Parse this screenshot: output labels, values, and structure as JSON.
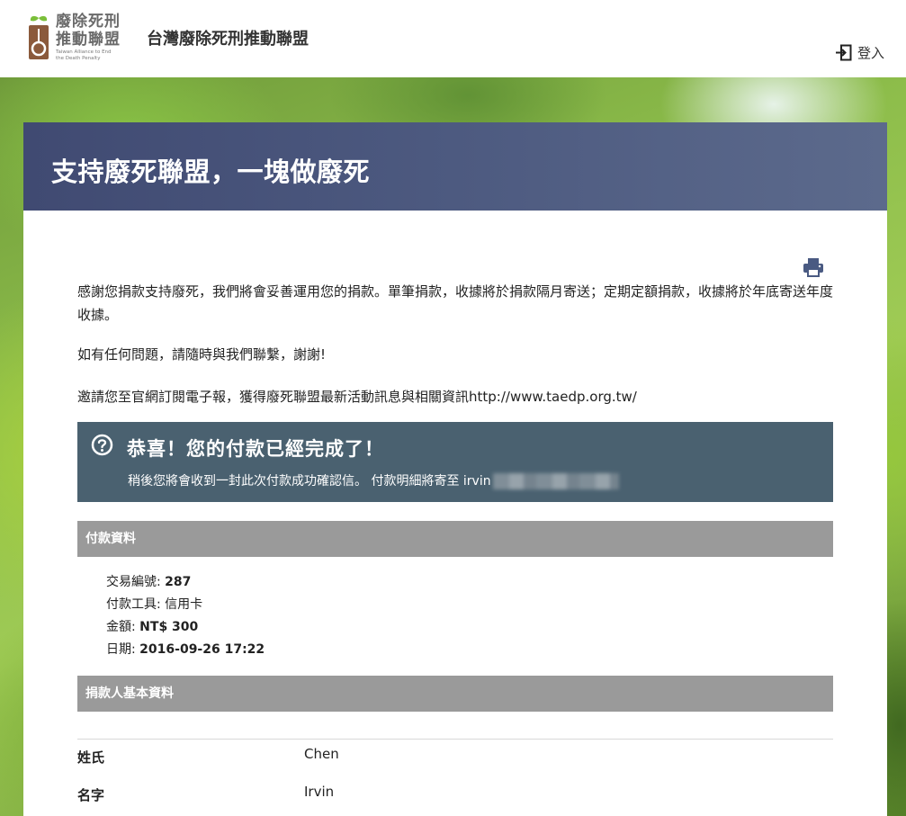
{
  "header": {
    "logo_cn_line1": "廢除死刑",
    "logo_cn_line2": "推動聯盟",
    "logo_en_line1": "Taiwan Alliance to End",
    "logo_en_line2": "the Death Penalty",
    "site_title": "台灣廢除死刑推動聯盟",
    "login_label": "登入",
    "login_icon": "sign-in-icon"
  },
  "page": {
    "title": "支持廢死聯盟，一塊做廢死",
    "print_icon": "print-icon",
    "paragraph1": "感謝您捐款支持廢死，我們將會妥善運用您的捐款。單筆捐款，收據將於捐款隔月寄送；定期定額捐款，收據將於年底寄送年度收據。",
    "paragraph2": "如有任何問題，請隨時與我們聯繫，謝謝!",
    "paragraph3": "邀請您至官網訂閱電子報，獲得廢死聯盟最新活動訊息與相關資訊http://www.taedp.org.tw/"
  },
  "success": {
    "icon": "question-circle-icon",
    "title": "恭喜！您的付款已經完成了！",
    "subtitle": "稍後您將會收到一封此次付款成功確認信。 付款明細將寄至 irvin"
  },
  "payment_section": {
    "heading": "付款資料",
    "fields": [
      {
        "label": "交易編號:",
        "value": "287"
      },
      {
        "label": "付款工具:",
        "value": "信用卡"
      },
      {
        "label": "金額:",
        "value": "NT$ 300"
      },
      {
        "label": "日期:",
        "value": "2016-09-26 17:22"
      }
    ]
  },
  "donor_section": {
    "heading": "捐款人基本資料",
    "rows": [
      {
        "label": "姓氏",
        "value": "Chen"
      },
      {
        "label": "名字",
        "value": "Irvin"
      }
    ]
  },
  "colors": {
    "header_band": "#4d5a80",
    "success_band": "#4a6170",
    "section_bar": "#9a9a9a"
  }
}
